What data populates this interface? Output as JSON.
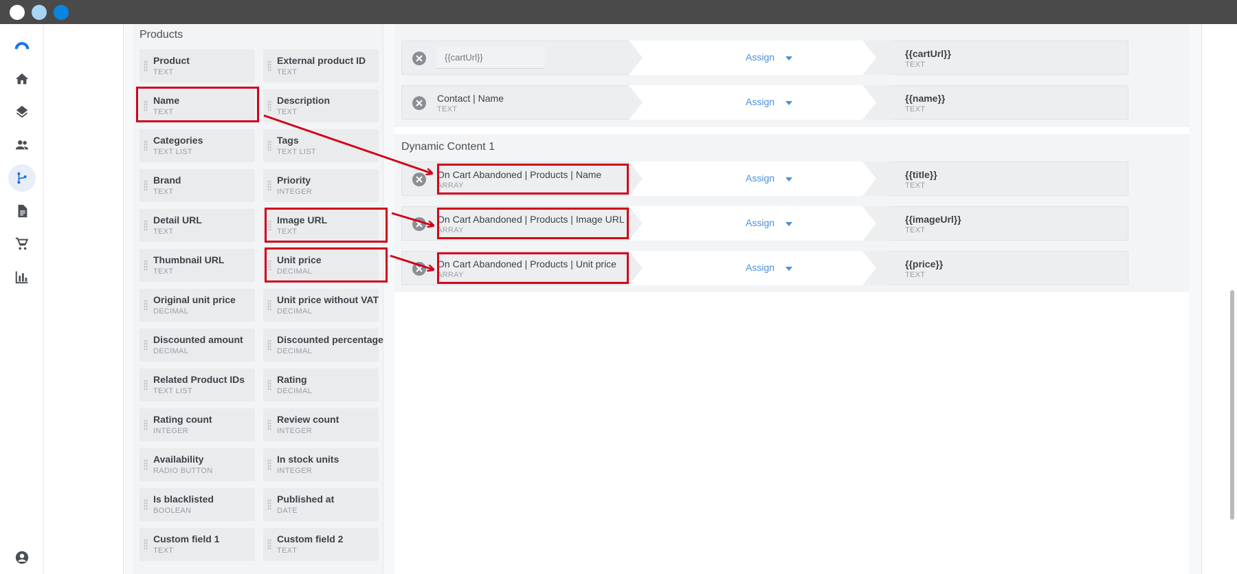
{
  "window": {
    "dots": [
      "#ffffff",
      "#a8d4f5",
      "#0a84e0"
    ]
  },
  "sidebar": {
    "items": [
      {
        "icon": "logo-icon"
      },
      {
        "icon": "home-icon"
      },
      {
        "icon": "layers-icon"
      },
      {
        "icon": "people-icon"
      },
      {
        "icon": "flow-icon",
        "active": true
      },
      {
        "icon": "document-icon"
      },
      {
        "icon": "cart-icon"
      },
      {
        "icon": "bar-chart-icon"
      },
      {
        "icon": "account-icon"
      }
    ]
  },
  "products": {
    "title": "Products",
    "fields": [
      {
        "name": "Product",
        "type": "TEXT"
      },
      {
        "name": "External product ID",
        "type": "TEXT"
      },
      {
        "name": "Name",
        "type": "TEXT"
      },
      {
        "name": "Description",
        "type": "TEXT"
      },
      {
        "name": "Categories",
        "type": "TEXT LIST"
      },
      {
        "name": "Tags",
        "type": "TEXT LIST"
      },
      {
        "name": "Brand",
        "type": "TEXT"
      },
      {
        "name": "Priority",
        "type": "INTEGER"
      },
      {
        "name": "Detail URL",
        "type": "TEXT"
      },
      {
        "name": "Image URL",
        "type": "TEXT"
      },
      {
        "name": "Thumbnail URL",
        "type": "TEXT"
      },
      {
        "name": "Unit price",
        "type": "DECIMAL"
      },
      {
        "name": "Original unit price",
        "type": "DECIMAL"
      },
      {
        "name": "Unit price without VAT",
        "type": "DECIMAL"
      },
      {
        "name": "Discounted amount",
        "type": "DECIMAL"
      },
      {
        "name": "Discounted percentage",
        "type": "DECIMAL"
      },
      {
        "name": "Related Product IDs",
        "type": "TEXT LIST"
      },
      {
        "name": "Rating",
        "type": "DECIMAL"
      },
      {
        "name": "Rating count",
        "type": "INTEGER"
      },
      {
        "name": "Review count",
        "type": "INTEGER"
      },
      {
        "name": "Availability",
        "type": "RADIO BUTTON"
      },
      {
        "name": "In stock units",
        "type": "INTEGER"
      },
      {
        "name": "Is blacklisted",
        "type": "BOOLEAN"
      },
      {
        "name": "Published at",
        "type": "DATE"
      },
      {
        "name": "Custom field 1",
        "type": "TEXT"
      },
      {
        "name": "Custom field 2",
        "type": "TEXT"
      }
    ]
  },
  "mapping": {
    "top_rows": [
      {
        "source_placeholder": "{{cartUrl}}",
        "assign": "Assign",
        "target": "{{cartUrl}}",
        "target_type": "TEXT"
      },
      {
        "source": "Contact | Name",
        "source_type": "TEXT",
        "assign": "Assign",
        "target": "{{name}}",
        "target_type": "TEXT"
      }
    ],
    "dynamic": {
      "title": "Dynamic Content 1",
      "rows": [
        {
          "source": "On Cart Abandoned | Products | Name",
          "source_type": "ARRAY",
          "assign": "Assign",
          "target": "{{title}}",
          "target_type": "TEXT"
        },
        {
          "source": "On Cart Abandoned | Products | Image URL",
          "source_type": "ARRAY",
          "assign": "Assign",
          "target": "{{imageUrl}}",
          "target_type": "TEXT"
        },
        {
          "source": "On Cart Abandoned | Products | Unit price",
          "source_type": "ARRAY",
          "assign": "Assign",
          "target": "{{price}}",
          "target_type": "TEXT"
        }
      ]
    }
  },
  "annotation_color": "#d0021b"
}
